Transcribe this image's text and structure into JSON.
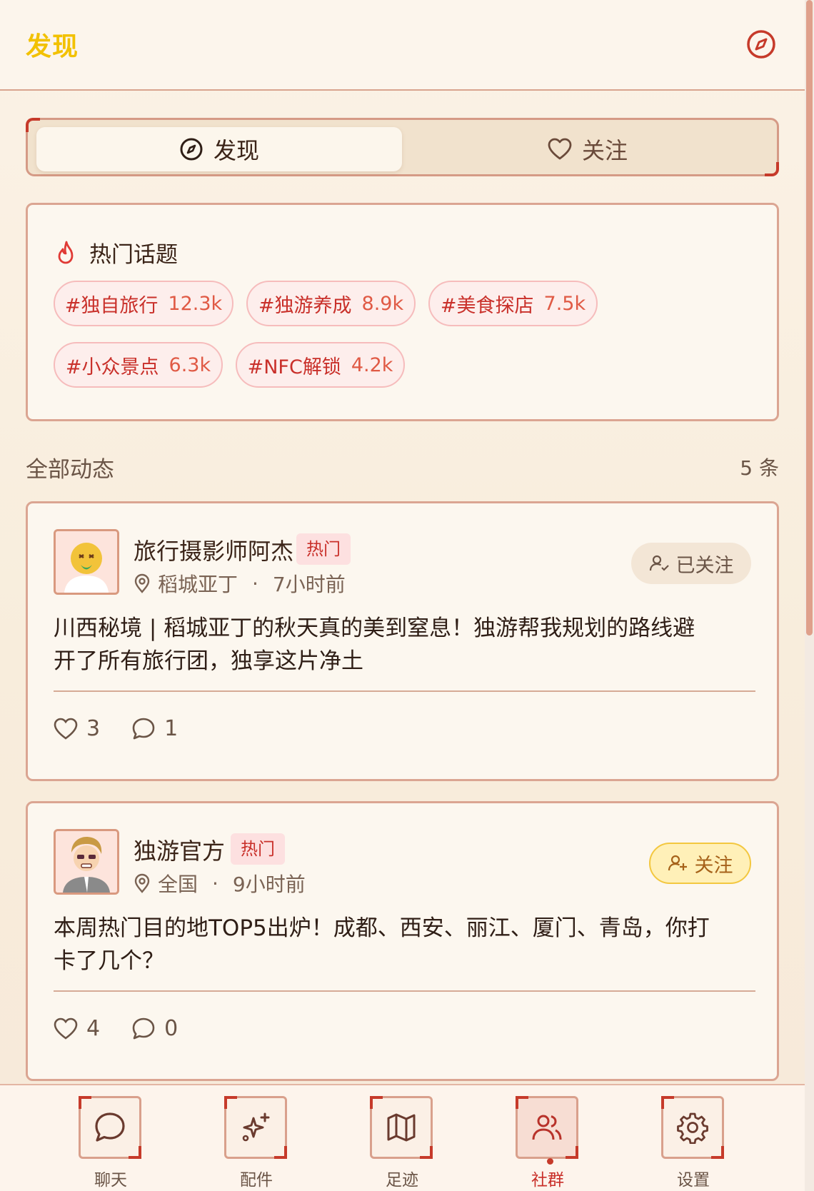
{
  "header": {
    "title": "发现",
    "icon": "compass-icon"
  },
  "segments": [
    {
      "label": "发现",
      "icon": "compass-icon",
      "active": true
    },
    {
      "label": "关注",
      "icon": "heart-icon",
      "active": false
    }
  ],
  "topics": {
    "title": "热门话题",
    "icon": "flame-icon",
    "items": [
      {
        "tag": "#独自旅行",
        "count": "12.3k"
      },
      {
        "tag": "#独游养成",
        "count": "8.9k"
      },
      {
        "tag": "#美食探店",
        "count": "7.5k"
      },
      {
        "tag": "#小众景点",
        "count": "6.3k"
      },
      {
        "tag": "#NFC解锁",
        "count": "4.2k"
      }
    ]
  },
  "feed": {
    "label": "全部动态",
    "count": "5 条",
    "posts": [
      {
        "author": "旅行摄影师阿杰",
        "badge": "热门",
        "location": "稻城亚丁",
        "time": "7小时前",
        "follow_label": "已关注",
        "followed": true,
        "text": "川西秘境 | 稻城亚丁的秋天真的美到窒息！独游帮我规划的路线避开了所有旅行团，独享这片净土",
        "likes": "3",
        "comments": "1"
      },
      {
        "author": "独游官方",
        "badge": "热门",
        "location": "全国",
        "time": "9小时前",
        "follow_label": "关注",
        "followed": false,
        "text": "本周热门目的地TOP5出炉！成都、西安、丽江、厦门、青岛，你打卡了几个？",
        "likes": "4",
        "comments": "0"
      }
    ]
  },
  "nav": [
    {
      "label": "聊天",
      "icon": "chat-icon",
      "active": false
    },
    {
      "label": "配件",
      "icon": "sparkle-icon",
      "active": false
    },
    {
      "label": "足迹",
      "icon": "map-icon",
      "active": false
    },
    {
      "label": "社群",
      "icon": "users-icon",
      "active": true
    },
    {
      "label": "设置",
      "icon": "gear-icon",
      "active": false
    }
  ],
  "colors": {
    "accent": "#c63a2a",
    "title": "#f2c100",
    "border": "#dba592"
  }
}
